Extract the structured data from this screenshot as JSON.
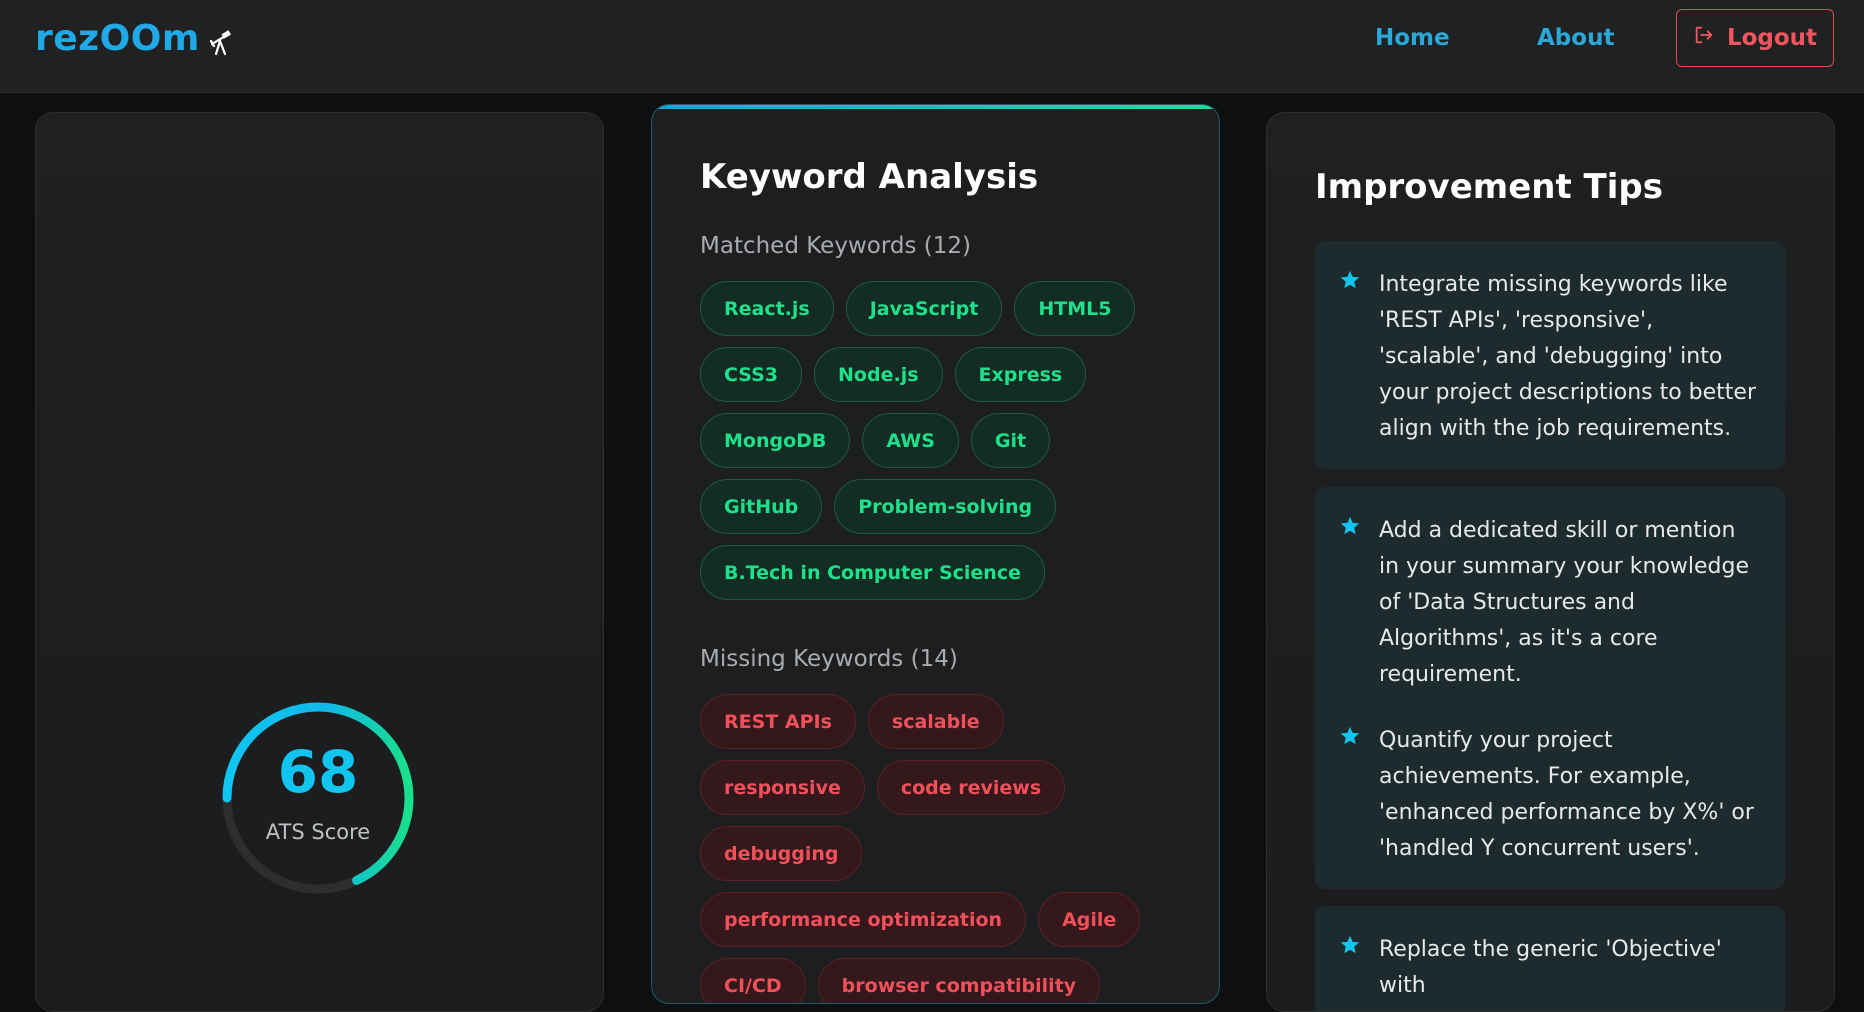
{
  "brand": {
    "name": "rezOOm",
    "icon": "telescope-icon"
  },
  "nav": {
    "home": "Home",
    "about": "About",
    "logout": "Logout",
    "logout_icon": "logout-icon"
  },
  "score": {
    "value": "68",
    "label": "ATS Score",
    "percent": 68
  },
  "keywords": {
    "title": "Keyword Analysis",
    "matched_label": "Matched Keywords (12)",
    "matched": [
      "React.js",
      "JavaScript",
      "HTML5",
      "CSS3",
      "Node.js",
      "Express",
      "MongoDB",
      "AWS",
      "Git",
      "GitHub",
      "Problem-solving",
      "B.Tech in Computer Science"
    ],
    "missing_label": "Missing Keywords (14)",
    "missing": [
      "REST APIs",
      "scalable",
      "responsive",
      "code reviews",
      "debugging",
      "performance optimization",
      "Agile",
      "CI/CD",
      "browser compatibility"
    ]
  },
  "tips": {
    "title": "Improvement Tips",
    "items": [
      "Integrate missing keywords like 'REST APIs', 'responsive', 'scalable', and 'debugging' into your project descriptions to better align with the job requirements.",
      "Add a dedicated skill or mention in your summary your knowledge of 'Data Structures and Algorithms', as it's a core requirement.",
      "Quantify your project achievements. For example, 'enhanced performance by X%' or 'handled Y concurrent users'.",
      "Replace the generic 'Objective' with"
    ]
  },
  "colors": {
    "accent": "#1fa9e6",
    "score": "#12c5f0",
    "match": "#1fe08a",
    "miss": "#f0505a",
    "logout": "#e2464f"
  }
}
